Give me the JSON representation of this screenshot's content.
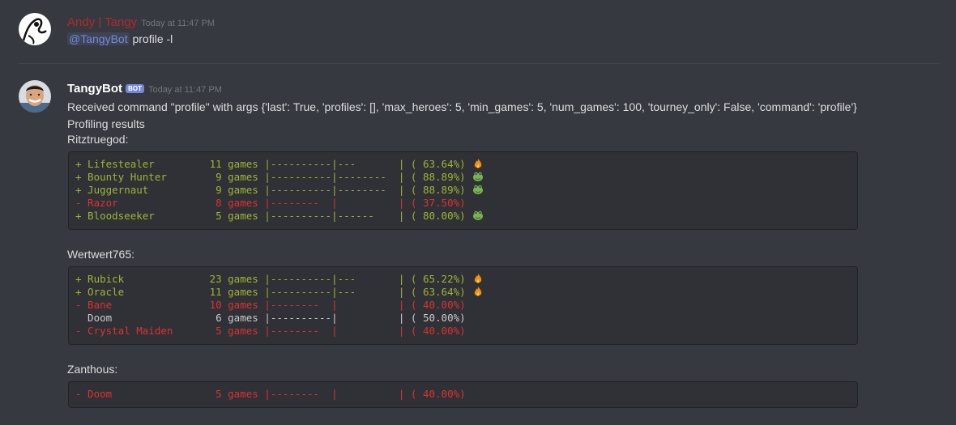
{
  "message1": {
    "username": "Andy | Tangy",
    "username_color": "#b32a2a",
    "timestamp": "Today at 11:47 PM",
    "mention": "@TangyBot",
    "text": " profile -l"
  },
  "message2": {
    "username": "TangyBot",
    "bot_tag": "BOT",
    "timestamp": "Today at 11:47 PM",
    "line1": "Received command \"profile\" with args {'last': True, 'profiles': [], 'max_heroes': 5, 'min_games': 5, 'num_games': 100, 'tourney_only': False, 'command': 'profile'}",
    "line2": "Profiling results",
    "profiles": [
      {
        "name": "Ritztruegod:",
        "rows": [
          {
            "text": "+ Lifestealer         11 games |----------|---       | ( 63.64%)",
            "status": "plus",
            "emoji": "fire-icon"
          },
          {
            "text": "+ Bounty Hunter        9 games |----------|--------  | ( 88.89%)",
            "status": "plus",
            "emoji": "frog-icon"
          },
          {
            "text": "+ Juggernaut           9 games |----------|--------  | ( 88.89%)",
            "status": "plus",
            "emoji": "frog-icon"
          },
          {
            "text": "- Razor                8 games |--------  |          | ( 37.50%)",
            "status": "minus",
            "emoji": ""
          },
          {
            "text": "+ Bloodseeker          5 games |----------|------    | ( 80.00%)",
            "status": "plus",
            "emoji": "frog-icon"
          }
        ]
      },
      {
        "name": "Wertwert765:",
        "rows": [
          {
            "text": "+ Rubick              23 games |----------|---       | ( 65.22%)",
            "status": "plus",
            "emoji": "fire-icon"
          },
          {
            "text": "+ Oracle              11 games |----------|---       | ( 63.64%)",
            "status": "plus",
            "emoji": "fire-icon"
          },
          {
            "text": "- Bane                10 games |--------  |          | ( 40.00%)",
            "status": "minus",
            "emoji": ""
          },
          {
            "text": "  Doom                 6 games |----------|          | ( 50.00%)",
            "status": "neutral",
            "emoji": ""
          },
          {
            "text": "- Crystal Maiden       5 games |--------  |          | ( 40.00%)",
            "status": "minus",
            "emoji": ""
          }
        ]
      },
      {
        "name": "Zanthous:",
        "rows": [
          {
            "text": "- Doom                 5 games |--------  |          | ( 40.00%)",
            "status": "minus",
            "emoji": ""
          }
        ]
      }
    ]
  },
  "colors": {
    "background": "#36393f",
    "codeblock": "#2f3136",
    "plus": "#9fb431",
    "minus": "#dc322f",
    "mention": "#7289da"
  }
}
